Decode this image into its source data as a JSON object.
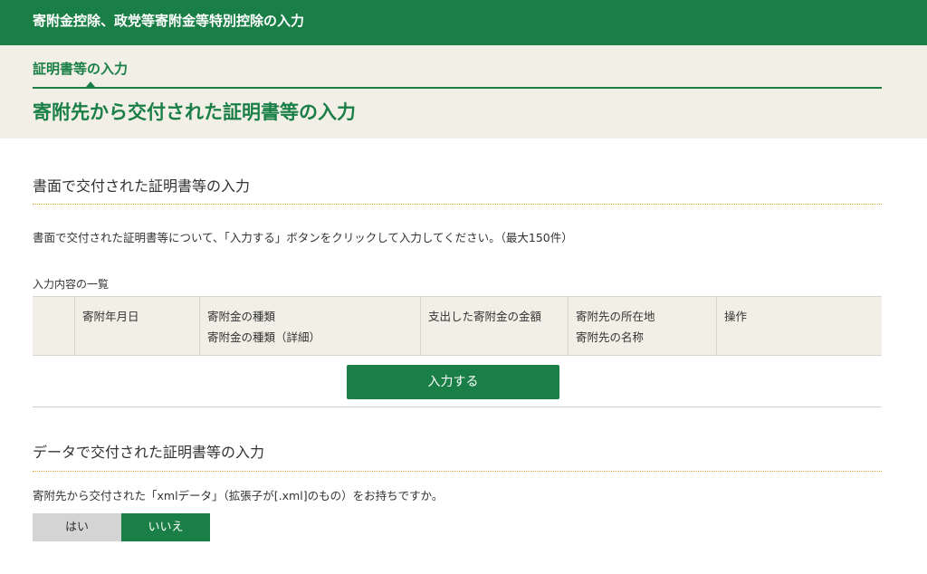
{
  "header": {
    "title": "寄附金控除、政党等寄附金等特別控除の入力"
  },
  "hero": {
    "step_label": "証明書等の入力",
    "page_title": "寄附先から交付された証明書等の入力"
  },
  "paper_section": {
    "title": "書面で交付された証明書等の入力",
    "instruction": "書面で交付された証明書等について、「入力する」ボタンをクリックして入力してください。（最大150件）",
    "list_label": "入力内容の一覧",
    "columns": [
      {
        "line1": "",
        "line2": ""
      },
      {
        "line1": "寄附年月日",
        "line2": ""
      },
      {
        "line1": "寄附金の種類",
        "line2": "寄附金の種類（詳細）"
      },
      {
        "line1": "支出した寄附金の金額",
        "line2": ""
      },
      {
        "line1": "寄附先の所在地",
        "line2": "寄附先の名称"
      },
      {
        "line1": "操作",
        "line2": ""
      }
    ],
    "input_button_label": "入力する"
  },
  "data_section": {
    "title": "データで交付された証明書等の入力",
    "question": "寄附先から交付された「xmlデータ」（拡張子が[.xml]のもの）をお持ちですか。",
    "yes_label": "はい",
    "no_label": "いいえ",
    "selected": "いいえ"
  },
  "colors": {
    "brand_green": "#1a7f46",
    "hero_background": "#f1efe6",
    "dotted_rule": "#e0ad3d",
    "unselected_toggle": "#d4d4d4"
  }
}
